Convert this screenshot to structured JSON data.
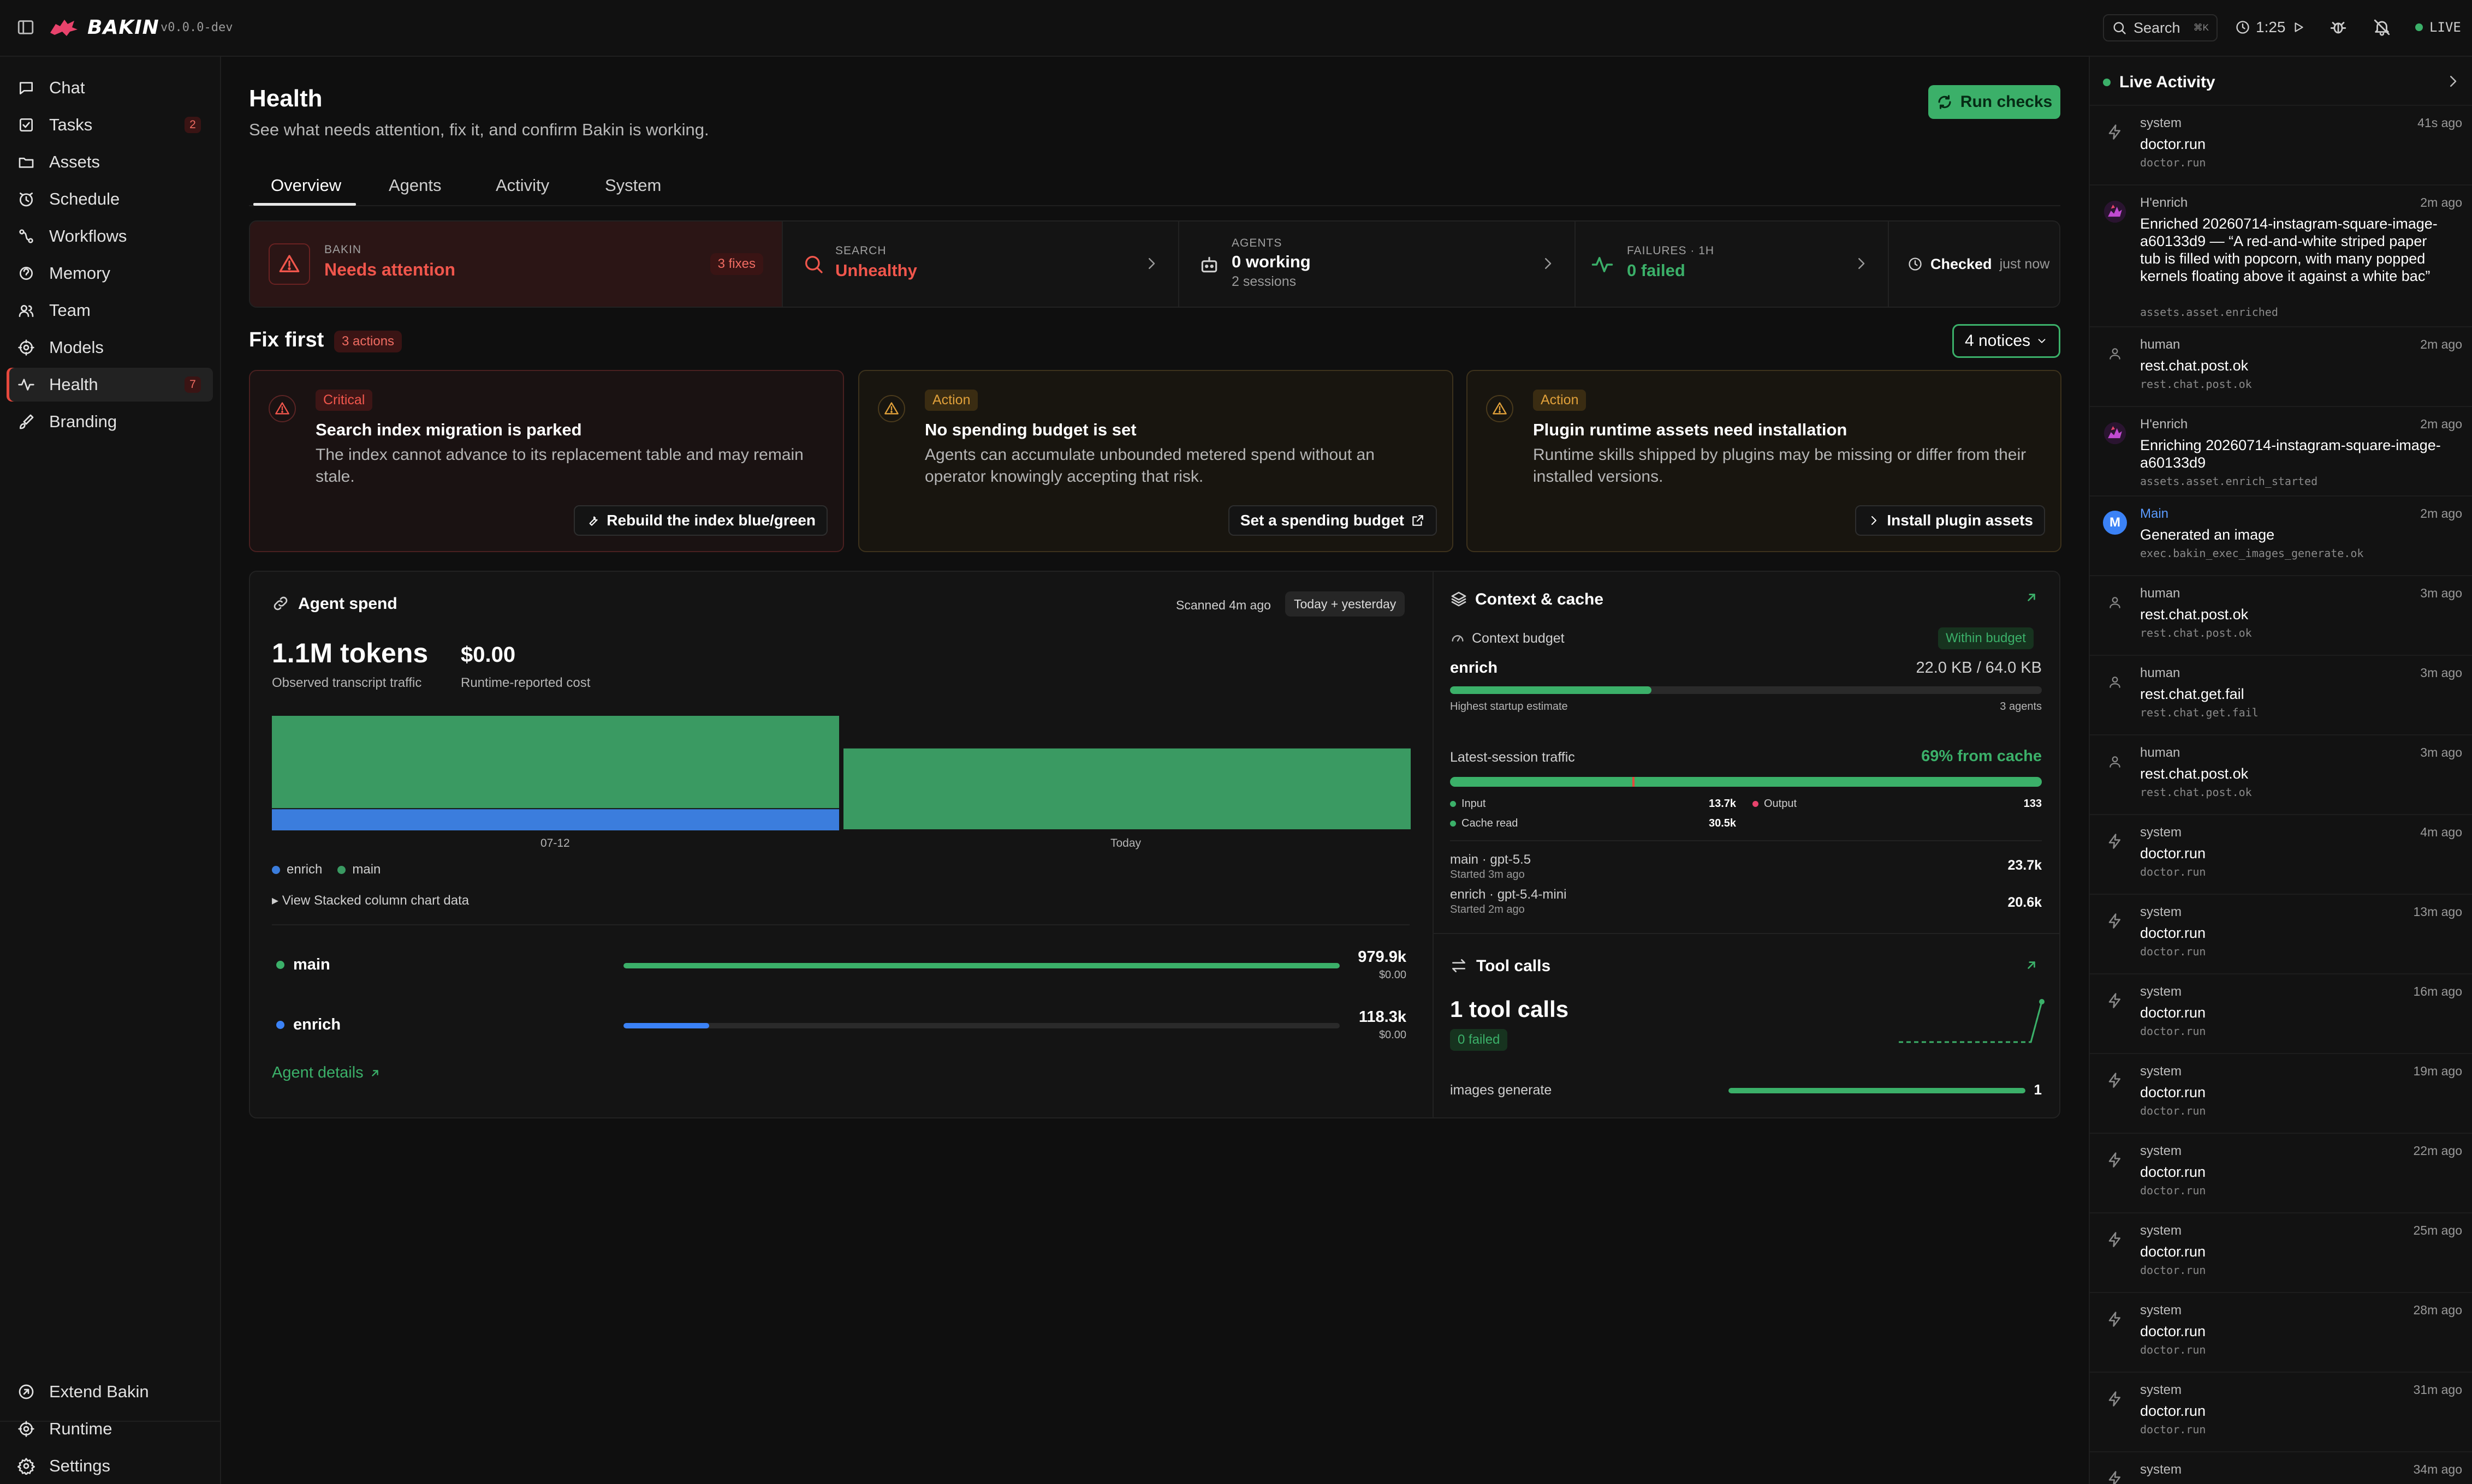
{
  "app": {
    "name": "BAKIN",
    "version": "v0.0.0-dev"
  },
  "topbar": {
    "search_label": "Search",
    "search_kbd": "⌘K",
    "timer": "1:25",
    "live_label": "LIVE"
  },
  "sidebar": {
    "items": [
      {
        "label": "Chat",
        "icon": "chat-icon"
      },
      {
        "label": "Tasks",
        "icon": "tasks-icon",
        "badge": "2"
      },
      {
        "label": "Assets",
        "icon": "folder-icon"
      },
      {
        "label": "Schedule",
        "icon": "clock-icon"
      },
      {
        "label": "Workflows",
        "icon": "workflow-icon"
      },
      {
        "label": "Memory",
        "icon": "memory-icon"
      },
      {
        "label": "Team",
        "icon": "team-icon"
      },
      {
        "label": "Models",
        "icon": "models-icon"
      },
      {
        "label": "Health",
        "icon": "health-icon",
        "badge": "7",
        "active": true
      },
      {
        "label": "Branding",
        "icon": "brush-icon"
      }
    ],
    "bottom": [
      {
        "label": "Extend Bakin",
        "icon": "extend-icon"
      },
      {
        "label": "Runtime",
        "icon": "runtime-icon"
      },
      {
        "label": "Settings",
        "icon": "gear-icon"
      }
    ]
  },
  "header": {
    "title": "Health",
    "subtitle": "See what needs attention, fix it, and confirm Bakin is working.",
    "run_checks": "Run checks"
  },
  "tabs": [
    "Overview",
    "Agents",
    "Activity",
    "System"
  ],
  "status": {
    "bakin": {
      "caption": "BAKIN",
      "value": "Needs attention",
      "badge": "3 fixes"
    },
    "search": {
      "caption": "SEARCH",
      "value": "Unhealthy"
    },
    "agents": {
      "caption": "AGENTS",
      "value": "0 working",
      "sub": "2 sessions"
    },
    "failures": {
      "caption": "FAILURES · 1H",
      "value": "0 failed"
    },
    "checked": {
      "label": "Checked",
      "value": "just now"
    }
  },
  "fix_first": {
    "title": "Fix first",
    "count": "3 actions",
    "notices": "4 notices",
    "cards": [
      {
        "tag": "Critical",
        "title": "Search index migration is parked",
        "body": "The index cannot advance to its replacement table and may remain stale.",
        "action": "Rebuild the index blue/green"
      },
      {
        "tag": "Action",
        "title": "No spending budget is set",
        "body": "Agents can accumulate unbounded metered spend without an operator knowingly accepting that risk.",
        "action": "Set a spending budget"
      },
      {
        "tag": "Action",
        "title": "Plugin runtime assets need installation",
        "body": "Runtime skills shipped by plugins may be missing or differ from their installed versions.",
        "action": "Install plugin assets"
      }
    ]
  },
  "agent_spend": {
    "title": "Agent spend",
    "scanned": "Scanned 4m ago",
    "range": "Today + yesterday",
    "tokens": "1.1M tokens",
    "tokens_label": "Observed transcript traffic",
    "cost": "$0.00",
    "cost_label": "Runtime-reported cost",
    "view_data": "View Stacked column chart data",
    "rows": [
      {
        "name": "main",
        "value": "979.9k",
        "cost": "$0.00",
        "fraction": 1.0,
        "color": "#3bb069"
      },
      {
        "name": "enrich",
        "value": "118.3k",
        "cost": "$0.00",
        "fraction": 0.12,
        "color": "#3b82f6"
      }
    ],
    "details_link": "Agent details"
  },
  "chart_data": {
    "type": "bar",
    "stacked": true,
    "categories": [
      "07-12",
      "Today"
    ],
    "series": [
      {
        "name": "enrich",
        "values": [
          118.3,
          0
        ],
        "color": "#3b7ddd"
      },
      {
        "name": "main",
        "values": [
          522,
          457.9
        ],
        "color": "#3a9a62"
      }
    ],
    "unit": "k tokens",
    "ylim": [
      0,
      640.3
    ]
  },
  "context": {
    "title": "Context & cache",
    "budget_label": "Context budget",
    "budget_badge": "Within budget",
    "agent": "enrich",
    "agent_value": "22.0 KB / 64.0 KB",
    "fraction": 0.34,
    "startup_label": "Highest startup estimate",
    "agents_count": "3 agents",
    "traffic_label": "Latest-session traffic",
    "cache_pct": "69% from cache",
    "input_label": "Input",
    "input_value": "13.7k",
    "output_label": "Output",
    "output_value": "133",
    "cache_label": "Cache read",
    "cache_value": "30.5k",
    "sessions": [
      {
        "name": "main · gpt-5.5",
        "started": "Started 3m ago",
        "value": "23.7k"
      },
      {
        "name": "enrich · gpt-5.4-mini",
        "started": "Started 2m ago",
        "value": "20.6k"
      }
    ]
  },
  "tool_calls": {
    "title": "Tool calls",
    "value": "1 tool calls",
    "failed": "0 failed",
    "row_label": "images generate",
    "row_value": "1"
  },
  "live_activity": {
    "title": "Live Activity",
    "items": [
      {
        "actor": "system",
        "time": "41s ago",
        "title": "doctor.run",
        "event": "doctor.run",
        "icon": "bolt-icon"
      },
      {
        "actor": "H'enrich",
        "time": "2m ago",
        "title": "Enriched 20260714-instagram-square-image-a60133d9 — “A red-and-white striped paper tub is filled with popcorn, with many popped kernels floating above it against a white bac”",
        "event": "assets.asset.enriched",
        "icon": "agent-icon"
      },
      {
        "actor": "human",
        "time": "2m ago",
        "title": "rest.chat.post.ok",
        "event": "rest.chat.post.ok",
        "icon": "user-icon"
      },
      {
        "actor": "H'enrich",
        "time": "2m ago",
        "title": "Enriching 20260714-instagram-square-image-a60133d9",
        "event": "assets.asset.enrich_started",
        "icon": "agent-icon"
      },
      {
        "actor": "Main",
        "time": "2m ago",
        "title": "Generated an image",
        "event": "exec.bakin_exec_images_generate.ok",
        "icon": "avatar-m",
        "avatar": "M"
      },
      {
        "actor": "human",
        "time": "3m ago",
        "title": "rest.chat.post.ok",
        "event": "rest.chat.post.ok",
        "icon": "user-icon"
      },
      {
        "actor": "human",
        "time": "3m ago",
        "title": "rest.chat.get.fail",
        "event": "rest.chat.get.fail",
        "icon": "user-icon"
      },
      {
        "actor": "human",
        "time": "3m ago",
        "title": "rest.chat.post.ok",
        "event": "rest.chat.post.ok",
        "icon": "user-icon"
      },
      {
        "actor": "system",
        "time": "4m ago",
        "title": "doctor.run",
        "event": "doctor.run",
        "icon": "bolt-icon"
      },
      {
        "actor": "system",
        "time": "13m ago",
        "title": "doctor.run",
        "event": "doctor.run",
        "icon": "bolt-icon"
      },
      {
        "actor": "system",
        "time": "16m ago",
        "title": "doctor.run",
        "event": "doctor.run",
        "icon": "bolt-icon"
      },
      {
        "actor": "system",
        "time": "19m ago",
        "title": "doctor.run",
        "event": "doctor.run",
        "icon": "bolt-icon"
      },
      {
        "actor": "system",
        "time": "22m ago",
        "title": "doctor.run",
        "event": "doctor.run",
        "icon": "bolt-icon"
      },
      {
        "actor": "system",
        "time": "25m ago",
        "title": "doctor.run",
        "event": "doctor.run",
        "icon": "bolt-icon"
      },
      {
        "actor": "system",
        "time": "28m ago",
        "title": "doctor.run",
        "event": "doctor.run",
        "icon": "bolt-icon"
      },
      {
        "actor": "system",
        "time": "31m ago",
        "title": "doctor.run",
        "event": "doctor.run",
        "icon": "bolt-icon"
      },
      {
        "actor": "system",
        "time": "34m ago",
        "title": "",
        "event": "",
        "icon": "bolt-icon"
      }
    ]
  },
  "colors": {
    "accent": "#3bb069",
    "danger": "#e5483d",
    "warning": "#d99a2b",
    "info": "#3b82f6"
  }
}
